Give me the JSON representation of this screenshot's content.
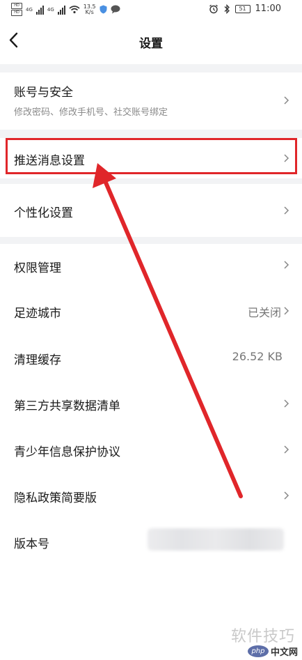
{
  "status_bar": {
    "sim1": "HD",
    "sim2": "HD",
    "net1": "4G",
    "net2": "4G",
    "speed_value": "13.5",
    "speed_unit": "K/s",
    "battery": "51",
    "time": "11:00"
  },
  "header": {
    "title": "设置"
  },
  "settings": [
    {
      "label": "账号与安全",
      "sub": "修改密码、修改手机号、社交账号绑定"
    },
    {
      "label": "推送消息设置"
    },
    {
      "label": "个性化设置"
    },
    {
      "label": "权限管理"
    },
    {
      "label": "足迹城市",
      "value": "已关闭"
    },
    {
      "label": "清理缓存",
      "value": "26.52 KB"
    },
    {
      "label": "第三方共享数据清单"
    },
    {
      "label": "青少年信息保护协议"
    },
    {
      "label": "隐私政策简要版"
    },
    {
      "label": "版本号"
    }
  ],
  "annotation": {
    "color": "#e0262a"
  },
  "watermark": {
    "text": "软件技巧",
    "logo": "php",
    "site": "中文网"
  }
}
